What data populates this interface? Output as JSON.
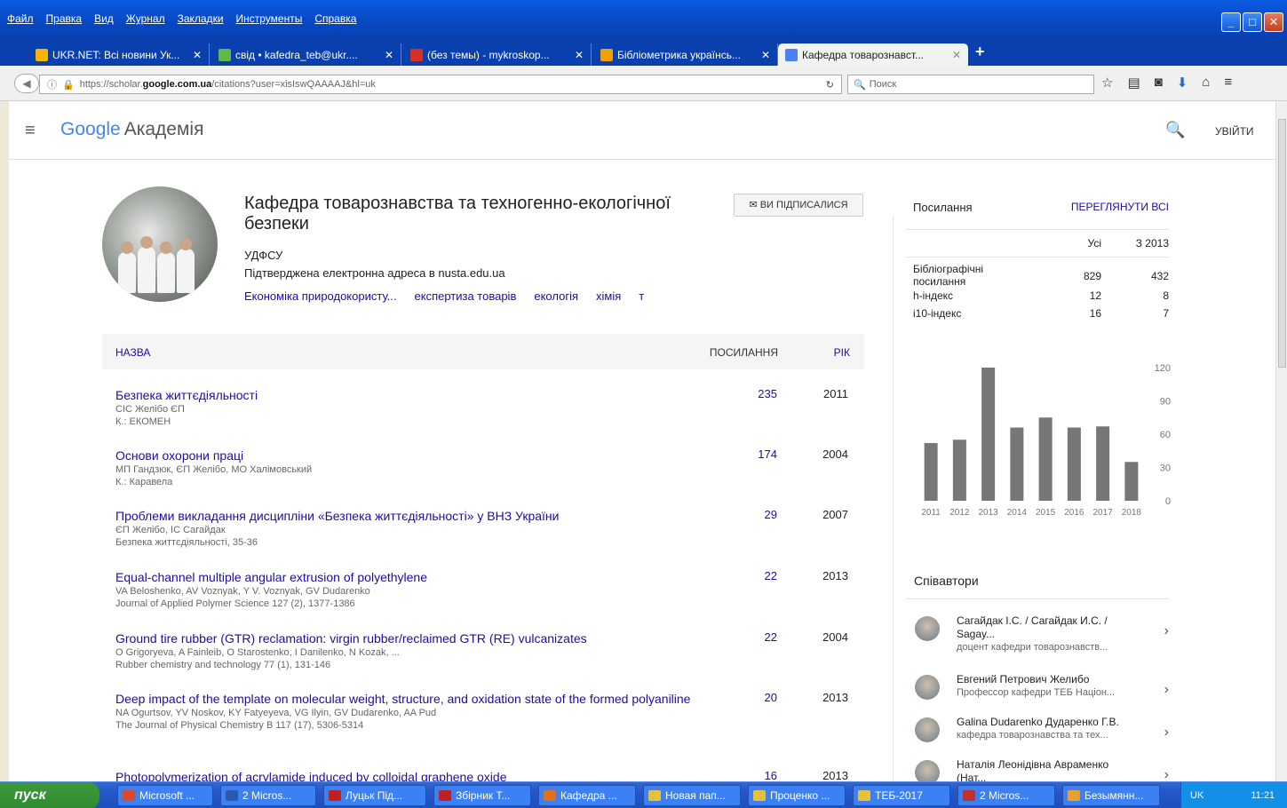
{
  "menu": [
    "Файл",
    "Правка",
    "Вид",
    "Журнал",
    "Закладки",
    "Инструменты",
    "Справка"
  ],
  "tabs": [
    {
      "label": "UKR.NET: Всі новини Ук...",
      "color": "#f6b400"
    },
    {
      "label": "свід • kafedra_teb@ukr....",
      "color": "#5fb84a"
    },
    {
      "label": "(без темы) - mykroskop...",
      "color": "#d93025"
    },
    {
      "label": "Бібліометрика українсь...",
      "color": "#f0a000"
    },
    {
      "label": "Кафедра товарознавст...",
      "color": "#4a80f0",
      "active": true
    }
  ],
  "toolbar": {
    "url_prefix": "https://scholar.",
    "url_domain": "google.com.ua",
    "url_suffix": "/citations?user=xisIswQAAAAJ&hl=uk",
    "search_placeholder": "Поиск"
  },
  "header": {
    "logo_brand": "Google",
    "logo_suffix": "Академія",
    "login": "УВІЙТИ"
  },
  "profile": {
    "name": "Кафедра товарознавства та техногенно-екологічної безпеки",
    "follow_label": "ВИ ПІДПИСАЛИСЯ",
    "affiliation": "УДФСУ",
    "email": "Підтверджена електронна адреса в nusta.edu.ua",
    "interests": [
      "Економіка природокористу...",
      "експертиза товарів",
      "екологія",
      "хімія",
      "т"
    ]
  },
  "table": {
    "col_title": "НАЗВА",
    "col_citations": "ПОСИЛАННЯ",
    "col_year": "РІК",
    "articles": [
      {
        "title": "Безпека життєдіяльності",
        "authors": "СІС Желібо ЄП",
        "venue": "К.: ЕКОМЕН",
        "citations": "235",
        "year": "2011"
      },
      {
        "title": "Основи охорони праці",
        "authors": "МП Гандзюк, ЄП Желібо, МО Халімовський",
        "venue": "К.: Каравела",
        "citations": "174",
        "year": "2004"
      },
      {
        "title": "Проблеми викладання дисципліни «Безпека життєдіяльності» у ВНЗ України",
        "authors": "ЄП Желібо, ІС Сагайдак",
        "venue": "Безпека життєдіяльності, 35-36",
        "citations": "29",
        "year": "2007"
      },
      {
        "title": "Equal-channel multiple angular extrusion of polyethylene",
        "authors": "VA Beloshenko, AV Voznyak, Y V. Voznyak, GV Dudarenko",
        "venue": "Journal of Applied Polymer Science 127 (2), 1377-1386",
        "citations": "22",
        "year": "2013"
      },
      {
        "title": "Ground tire rubber (GTR) reclamation: virgin rubber/reclaimed GTR (RE) vulcanizates",
        "authors": "O Grigoryeva, A Fainleib, O Starostenko, I Danilenko, N Kozak, ...",
        "venue": "Rubber chemistry and technology 77 (1), 131-146",
        "citations": "22",
        "year": "2004"
      },
      {
        "title": "Deep impact of the template on molecular weight, structure, and oxidation state of the formed polyaniline",
        "authors": "NA Ogurtsov, YV Noskov, KY Fatyeyeva, VG Ilyin, GV Dudarenko, AA Pud",
        "venue": "The Journal of Physical Chemistry B 117 (17), 5306-5314",
        "citations": "20",
        "year": "2013"
      },
      {
        "title": "Photopolymerization of acrylamide induced by colloidal graphene oxide",
        "authors": "",
        "venue": "",
        "citations": "16",
        "year": "2013"
      }
    ]
  },
  "cited_by": {
    "title": "Посилання",
    "view_all": "ПЕРЕГЛЯНУТИ ВСІ",
    "col_all": "Усі",
    "col_since": "З 2013",
    "rows": [
      {
        "label": "Бібліографічні посилання",
        "all": "829",
        "since": "432"
      },
      {
        "label": "h-індекс",
        "all": "12",
        "since": "8"
      },
      {
        "label": "i10-індекс",
        "all": "16",
        "since": "7"
      }
    ]
  },
  "chart_data": {
    "type": "bar",
    "categories": [
      "2011",
      "2012",
      "2013",
      "2014",
      "2015",
      "2016",
      "2017",
      "2018"
    ],
    "values": [
      52,
      55,
      120,
      66,
      75,
      66,
      67,
      35
    ],
    "ylim": [
      0,
      120
    ],
    "yticks": [
      "0",
      "30",
      "60",
      "90",
      "120"
    ],
    "bar_color": "#777777"
  },
  "coauthors": {
    "title": "Співавтори",
    "items": [
      {
        "name": "Сагайдак І.С. / Сагайдак И.С. / Sagay...",
        "affil": "доцент кафедри товарознавств..."
      },
      {
        "name": "Евгений Петрович Желибо",
        "affil": "Профессор кафедри ТЕБ Націон..."
      },
      {
        "name": "Galina Dudarenko Дударенко Г.В.",
        "affil": "кафедра товарознавства та тех..."
      },
      {
        "name": "Наталія Леонідівна Авраменко (Нат...",
        "affil": ""
      }
    ]
  },
  "taskbar": {
    "start": "пуск",
    "tasks": [
      {
        "label": "Microsoft ...",
        "color": "#d84a2a"
      },
      {
        "label": "2 Micros...",
        "color": "#2a5ab0"
      },
      {
        "label": "Луцьк Під...",
        "color": "#c02020"
      },
      {
        "label": "Збірник Т...",
        "color": "#c02020"
      },
      {
        "label": "Кафедра ...",
        "color": "#e07020"
      },
      {
        "label": "Новая пап...",
        "color": "#e8c040"
      },
      {
        "label": "Проценко ...",
        "color": "#e8c040"
      },
      {
        "label": "ТЕБ-2017",
        "color": "#e8c040"
      },
      {
        "label": "2 Micros...",
        "color": "#c03030"
      },
      {
        "label": "Безымянн...",
        "color": "#e8a030"
      }
    ],
    "lang": "UK",
    "time": "11:21"
  }
}
